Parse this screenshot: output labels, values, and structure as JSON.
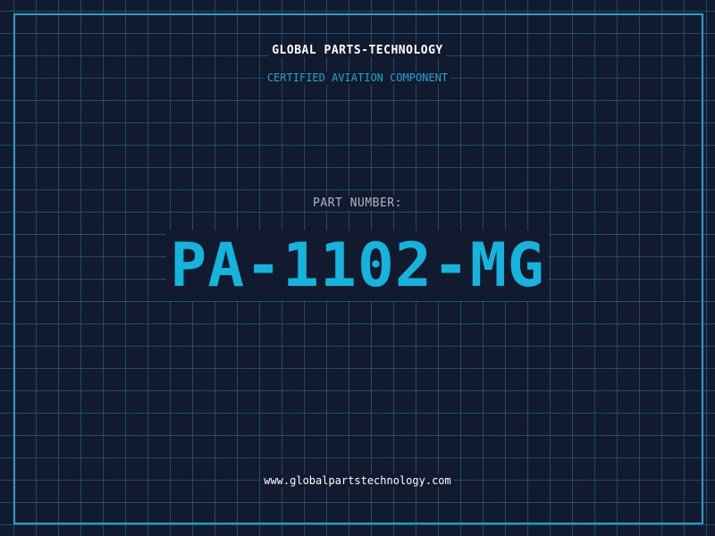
{
  "header": {
    "company": "GLOBAL PARTS-TECHNOLOGY",
    "tagline": "CERTIFIED AVIATION COMPONENT"
  },
  "part": {
    "label": "PART NUMBER:",
    "number": "PA-1102-MG"
  },
  "footer": {
    "website": "www.globalpartstechnology.com"
  },
  "colors": {
    "background": "#121a30",
    "grid": "#2278a0",
    "accent": "#17a4cf",
    "text": "#ffffff"
  }
}
